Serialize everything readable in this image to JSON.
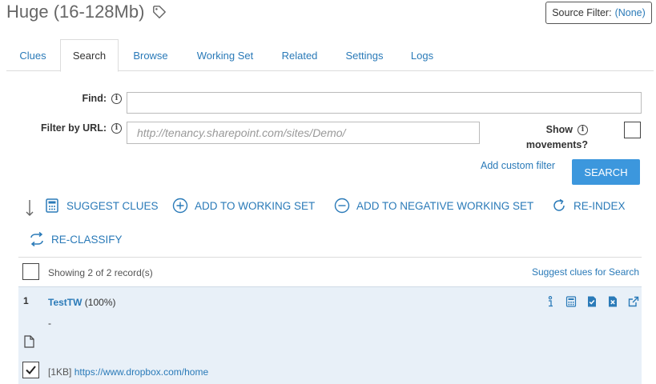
{
  "header": {
    "title": "Huge (16-128Mb)",
    "source_filter_label": "Source Filter:",
    "source_filter_value": "(None)"
  },
  "tabs": [
    {
      "label": "Clues"
    },
    {
      "label": "Search",
      "active": true
    },
    {
      "label": "Browse"
    },
    {
      "label": "Working Set"
    },
    {
      "label": "Related"
    },
    {
      "label": "Settings"
    },
    {
      "label": "Logs"
    }
  ],
  "search_form": {
    "find_label": "Find:",
    "find_value": "",
    "url_label": "Filter by URL:",
    "url_placeholder": "http://tenancy.sharepoint.com/sites/Demo/",
    "movements_label_1": "Show",
    "movements_label_2": "movements?",
    "add_custom_filter": "Add custom filter",
    "search_button": "SEARCH"
  },
  "actions": {
    "suggest_clues": "SUGGEST CLUES",
    "add_to_working_set": "ADD TO WORKING SET",
    "add_to_negative": "ADD TO NEGATIVE WORKING SET",
    "reindex": "RE-INDEX",
    "reclassify": "RE-CLASSIFY"
  },
  "results": {
    "showing": "Showing 2 of 2 record(s)",
    "suggest_for_search": "Suggest clues for Search"
  },
  "record": {
    "index": "1",
    "name": "TestTW",
    "score": "(100%)",
    "dash": "-",
    "size": "[1KB]",
    "url": "https://www.dropbox.com/home"
  },
  "colors": {
    "accent": "#2a7ab8",
    "button": "#3c97dd",
    "record_bg": "#e8f0f8"
  }
}
